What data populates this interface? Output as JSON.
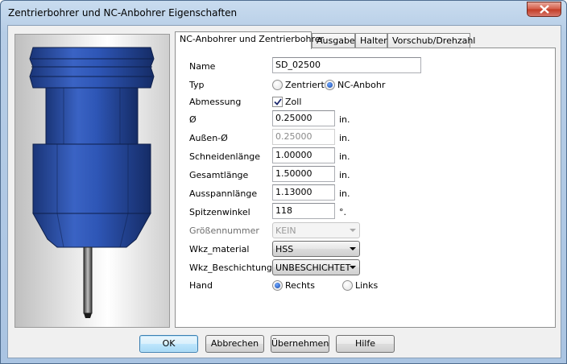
{
  "window": {
    "title": "Zentrierbohrer und NC-Anbohrer Eigenschaften"
  },
  "tabs": [
    {
      "label": "NC-Anbohrer und Zentrierbohrer",
      "active": true
    },
    {
      "label": "Ausgabe",
      "active": false
    },
    {
      "label": "Halter",
      "active": false
    },
    {
      "label": "Vorschub/Drehzahl",
      "active": false
    }
  ],
  "form": {
    "name": {
      "label": "Name",
      "value": "SD_02500"
    },
    "typ": {
      "label": "Typ",
      "option1": "Zentriert",
      "option2": "NC-Anbohr",
      "selected": "NC-Anbohr"
    },
    "abmessung": {
      "label": "Abmessung",
      "checkbox_label": "Zoll",
      "checked": true
    },
    "diameter": {
      "label": "Ø",
      "value": "0.25000",
      "unit": "in."
    },
    "outer_diameter": {
      "label": "Außen-Ø",
      "value": "0.25000",
      "unit": "in."
    },
    "cutting_length": {
      "label": "Schneidenlänge",
      "value": "1.00000",
      "unit": "in."
    },
    "total_length": {
      "label": "Gesamtlänge",
      "value": "1.50000",
      "unit": "in."
    },
    "clamp_length": {
      "label": "Ausspannlänge",
      "value": "1.13000",
      "unit": "in."
    },
    "tip_angle": {
      "label": "Spitzenwinkel",
      "value": "118",
      "unit": "°."
    },
    "size_number": {
      "label": "Größennummer",
      "value": "KEIN"
    },
    "material": {
      "label": "Wkz_material",
      "value": "HSS"
    },
    "coating": {
      "label": "Wkz_Beschichtung",
      "value": "UNBESCHICHTET"
    },
    "hand": {
      "label": "Hand",
      "option1": "Rechts",
      "option2": "Links",
      "selected": "Rechts"
    }
  },
  "buttons": {
    "ok": "OK",
    "cancel": "Abbrechen",
    "apply": "Übernehmen",
    "help": "Hilfe"
  },
  "colors": {
    "tool_blue": "#2a4f9e",
    "close_red": "#c23b24",
    "default_button_border": "#3c7fb1"
  }
}
